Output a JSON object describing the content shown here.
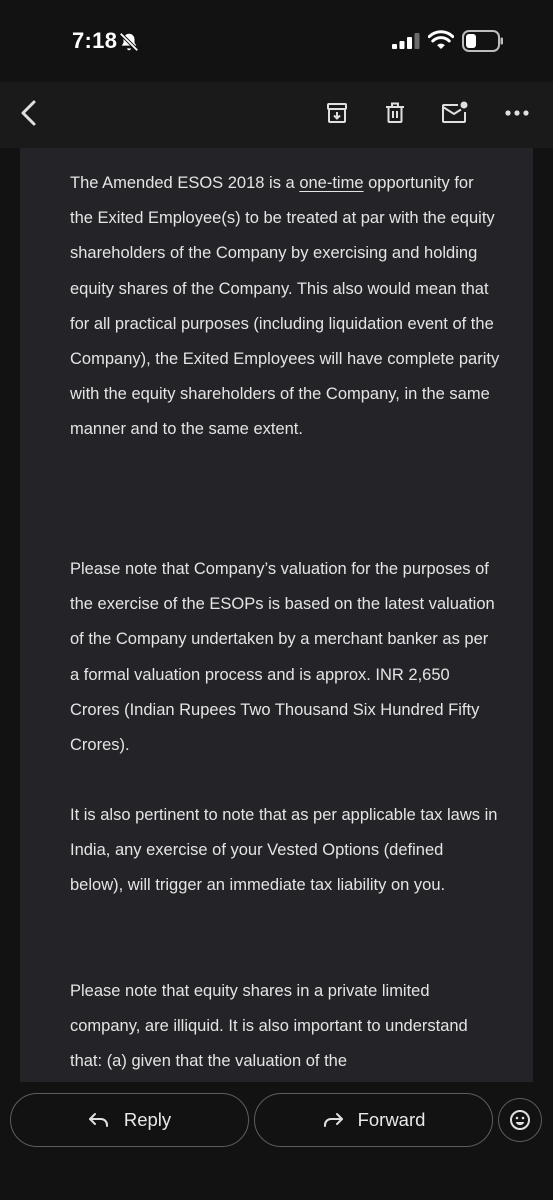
{
  "status_bar": {
    "time": "7:18",
    "icons": [
      "bell-slash-icon",
      "cellular-signal-icon",
      "wifi-icon",
      "battery-icon"
    ]
  },
  "background_text": [
    "...",
    "...",
    "...",
    "..."
  ],
  "toolbar": {
    "icons": [
      "back-arrow-icon",
      "archive-icon",
      "trash-icon",
      "mark-unread-icon",
      "more-icon"
    ]
  },
  "message": {
    "p1_before": "The Amended ESOS 2018 is a ",
    "p1_underlined": "one-time",
    "p1_after": " opportunity for the Exited Employee(s) to be treated at par with the equity shareholders of the Company by exercising and holding equity shares of the Company. This also would mean that for all practical purposes (including liquidation event of the Company), the Exited Employees will have complete parity with the equity shareholders of the Company, in the same manner and to the same extent.",
    "p2": "Please note that Company’s valuation for the purposes of the exercise of the ESOPs is based on the latest valuation of the Company undertaken by a merchant banker as per a formal valuation process and is approx. INR 2,650 Crores (Indian Rupees Two Thousand Six Hundred Fifty Crores).",
    "p3": "It is also pertinent to note that as per applicable tax laws in India, any exercise of your Vested Options (defined below), will trigger an immediate tax liability on you.",
    "p4": "Please note that equity shares in a private limited company, are illiquid. It is also important to understand that: (a) given that the valuation of the"
  },
  "actions": {
    "reply_label": "Reply",
    "forward_label": "Forward"
  },
  "colors": {
    "background": "#121212",
    "message_card": "#242327",
    "text": "#e4e4e4",
    "outline": "#5d5d62"
  }
}
